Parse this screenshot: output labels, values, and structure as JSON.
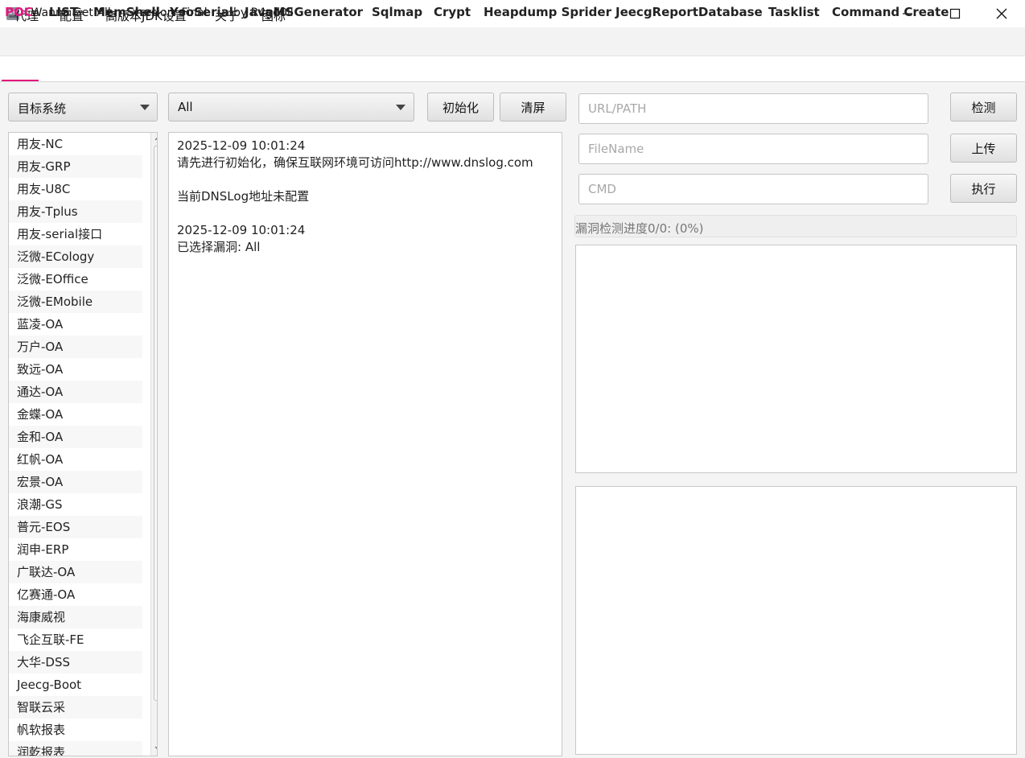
{
  "window": {
    "title": "I Wanna Get All    --version  Final     --by R4gd0ll",
    "controls": [
      "minimize",
      "maximize",
      "close"
    ]
  },
  "menu": [
    "代理",
    "配置",
    "高版本JDK设置",
    "关于",
    "图标"
  ],
  "tabs": [
    {
      "label": "POC",
      "active": true
    },
    {
      "label": "LIST"
    },
    {
      "label": "MemShell"
    },
    {
      "label": "YsoSerial"
    },
    {
      "label": "JavaMSGenerator"
    },
    {
      "label": "Sqlmap"
    },
    {
      "label": "Crypt"
    },
    {
      "label": "Heapdump Sprider"
    },
    {
      "label": "JeecgReportDatabase"
    },
    {
      "label": "Tasklist"
    },
    {
      "label": "Command Create"
    }
  ],
  "controls": {
    "target_system": "目标系统",
    "vuln_select": "All",
    "init_button": "初始化",
    "clear_button": "清屏",
    "url_placeholder": "URL/PATH",
    "filename_placeholder": "FileName",
    "cmd_placeholder": "CMD",
    "detect_button": "检测",
    "upload_button": "上传",
    "exec_button": "执行"
  },
  "target_list": [
    "用友-NC",
    "用友-GRP",
    "用友-U8C",
    "用友-Tplus",
    "用友-serial接口",
    "泛微-ECology",
    "泛微-EOffice",
    "泛微-EMobile",
    "蓝凌-OA",
    "万户-OA",
    "致远-OA",
    "通达-OA",
    "金蝶-OA",
    "金和-OA",
    "红帆-OA",
    "宏景-OA",
    "浪潮-GS",
    "普元-EOS",
    "润申-ERP",
    "广联达-OA",
    "亿赛通-OA",
    "海康威视",
    "飞企互联-FE",
    "大华-DSS",
    "Jeecg-Boot",
    "智联云采",
    "帆软报表",
    "润乾报表"
  ],
  "log": [
    "2025-12-09 10:01:24",
    "请先进行初始化，确保互联网环境可访问http://www.dnslog.com",
    "",
    "当前DNSLog地址未配置",
    "",
    "2025-12-09 10:01:24",
    "已选择漏洞: All"
  ],
  "progress": {
    "label": "漏洞检测进度0/0: (0%)",
    "percent": 0
  },
  "colors": {
    "active_tab": "#e4177f",
    "progress_fill": "#3a8ee6"
  }
}
